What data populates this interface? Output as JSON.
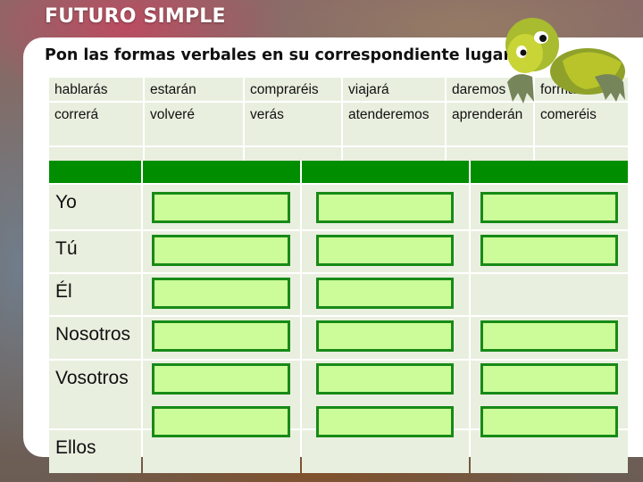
{
  "slide": {
    "title": "FUTURO SIMPLE",
    "instruction": "Pon las formas verbales en su correspondiente lugar."
  },
  "verb_bank": {
    "rows": [
      [
        "hablarás",
        "estarán",
        "compraréis",
        "viajará",
        "daremos",
        "formaré"
      ],
      [
        "correrá",
        "volveré",
        "verás",
        "atenderemos",
        "aprenderán",
        "comeréis"
      ],
      [
        "",
        "",
        "",
        "",
        "",
        ""
      ]
    ],
    "note": "third row is clipped behind the green header"
  },
  "conjugation_table": {
    "header": [
      "",
      "",
      "",
      ""
    ],
    "header_color": "#008e00",
    "answer_box_fill": "#ccfc99",
    "answer_box_border": "#178a17",
    "rows": [
      {
        "pronoun": "Yo",
        "slots": [
          true,
          true,
          true
        ]
      },
      {
        "pronoun": "Tú",
        "slots": [
          true,
          true,
          true
        ]
      },
      {
        "pronoun": "Él",
        "slots": [
          true,
          true,
          false
        ]
      },
      {
        "pronoun": "Nosotros",
        "slots": [
          true,
          true,
          true
        ]
      },
      {
        "pronoun": "Vosotros",
        "slots": [
          true,
          true,
          true
        ]
      },
      {
        "pronoun": "Ellos",
        "slots": [
          true,
          true,
          true
        ]
      }
    ]
  },
  "decoration": {
    "mascot": "turtle-icon"
  }
}
